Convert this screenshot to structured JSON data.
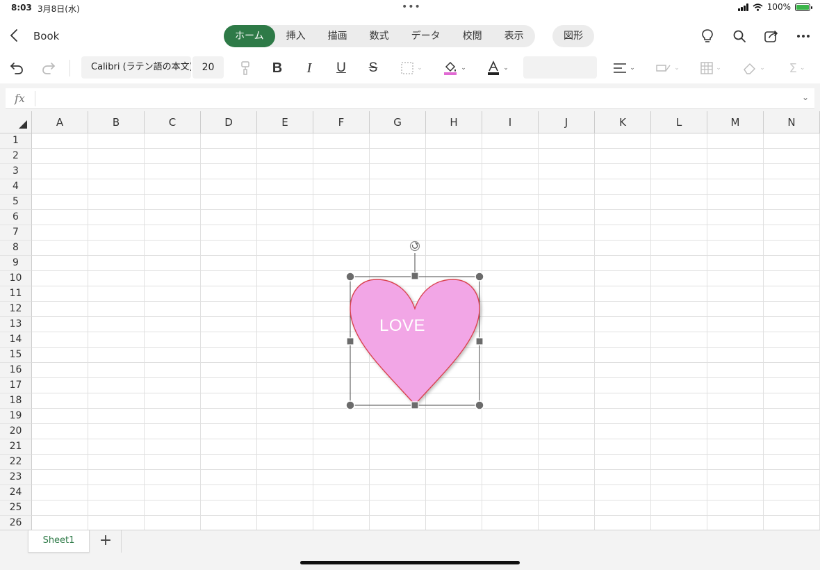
{
  "status_bar": {
    "time": "8:03",
    "date": "3月8日(水)",
    "battery": "100%"
  },
  "top_bar": {
    "back_icon": "chevron-left-icon",
    "title": "Book",
    "tabs": [
      {
        "label": "ホーム",
        "active": true
      },
      {
        "label": "挿入"
      },
      {
        "label": "描画"
      },
      {
        "label": "数式"
      },
      {
        "label": "データ"
      },
      {
        "label": "校閲"
      },
      {
        "label": "表示"
      }
    ],
    "shape_tab": "図形",
    "icons": [
      "lightbulb-icon",
      "search-icon",
      "share-icon",
      "more-icon"
    ]
  },
  "ribbon": {
    "font_name": "Calibri (ラテン語の本文)",
    "font_size": "20",
    "bold": "B",
    "italic": "I",
    "underline": "U",
    "strikethrough": "S"
  },
  "formula_bar": {
    "label": "fx",
    "value": ""
  },
  "grid": {
    "columns": [
      "A",
      "B",
      "C",
      "D",
      "E",
      "F",
      "G",
      "H",
      "I",
      "J",
      "K",
      "L",
      "M",
      "N"
    ],
    "rows": [
      "1",
      "2",
      "3",
      "4",
      "5",
      "6",
      "7",
      "8",
      "9",
      "10",
      "11",
      "12",
      "13",
      "14",
      "15",
      "16",
      "17",
      "18",
      "19",
      "20",
      "21",
      "22",
      "23",
      "24",
      "25",
      "26"
    ]
  },
  "shape": {
    "type": "heart",
    "text": "LOVE",
    "fill_color": "#f2a6e6",
    "outline_color": "#d9434f"
  },
  "sheets": {
    "tabs": [
      "Sheet1"
    ],
    "add_label": "+"
  },
  "colors": {
    "accent": "#2e7a47"
  }
}
